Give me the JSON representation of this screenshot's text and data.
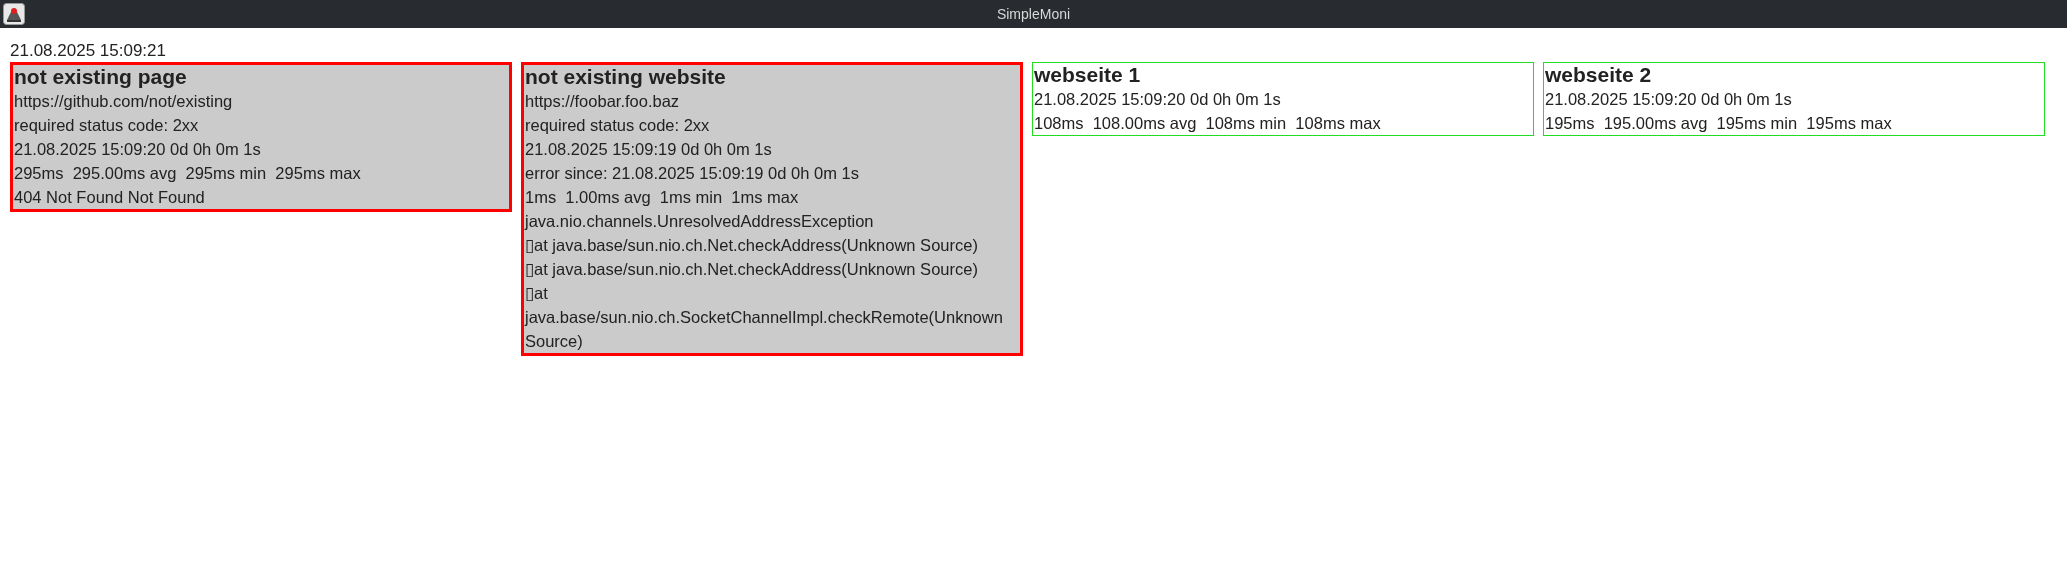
{
  "window": {
    "title": "SimpleMoni"
  },
  "timestamp": "21.08.2025 15:09:21",
  "monitors": [
    {
      "error": true,
      "name": "not existing page",
      "lines": [
        "https://github.com/not/existing",
        "required status code: 2xx",
        "21.08.2025 15:09:20 0d 0h 0m 1s",
        "295ms  295.00ms avg  295ms min  295ms max",
        "404 Not Found Not Found"
      ]
    },
    {
      "error": true,
      "name": "not existing website",
      "lines": [
        "https://foobar.foo.baz",
        "required status code: 2xx",
        "21.08.2025 15:09:19 0d 0h 0m 1s",
        "error since: 21.08.2025 15:09:19 0d 0h 0m 1s",
        "1ms  1.00ms avg  1ms min  1ms max",
        "java.nio.channels.UnresolvedAddressException",
        "▯at java.base/sun.nio.ch.Net.checkAddress(Unknown Source)",
        "▯at java.base/sun.nio.ch.Net.checkAddress(Unknown Source)",
        "▯at java.base/sun.nio.ch.SocketChannelImpl.checkRemote(Unknown Source)"
      ]
    },
    {
      "error": false,
      "name": "webseite 1",
      "lines": [
        "21.08.2025 15:09:20 0d 0h 0m 1s",
        "108ms  108.00ms avg  108ms min  108ms max"
      ]
    },
    {
      "error": false,
      "name": "webseite 2",
      "lines": [
        "21.08.2025 15:09:20 0d 0h 0m 1s",
        "195ms  195.00ms avg  195ms min  195ms max"
      ]
    }
  ]
}
